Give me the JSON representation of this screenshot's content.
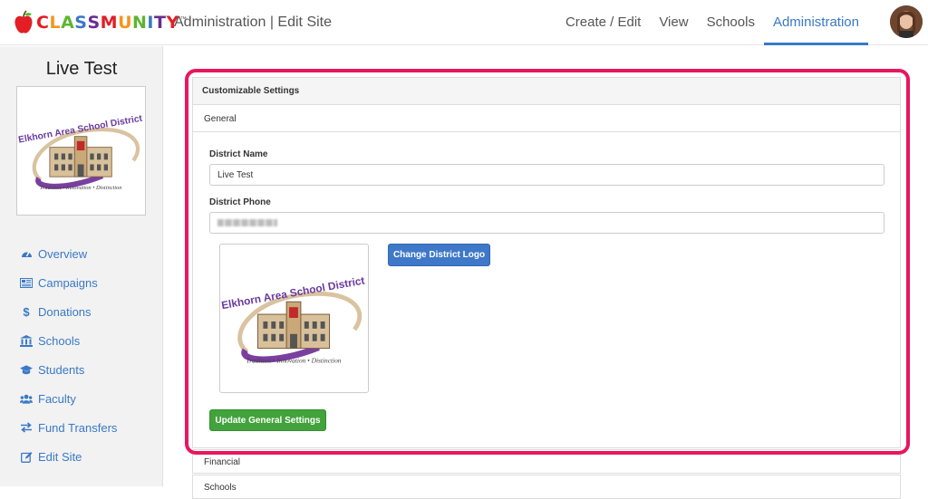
{
  "app": {
    "brand": "CLASSMUNITY",
    "brand_tm": "™",
    "page_title": "Administration | Edit Site",
    "brand_colors": [
      "#e31e24",
      "#f7941d",
      "#5cb531",
      "#3a79c6",
      "#662d91"
    ]
  },
  "nav": {
    "items": [
      {
        "label": "Create / Edit"
      },
      {
        "label": "View"
      },
      {
        "label": "Schools"
      },
      {
        "label": "Administration"
      }
    ],
    "active": "Administration",
    "accent": "#3a79c6"
  },
  "sidebar": {
    "site_name": "Live Test",
    "items": [
      {
        "label": "Overview",
        "icon": "dashboard-icon"
      },
      {
        "label": "Campaigns",
        "icon": "newspaper-icon"
      },
      {
        "label": "Donations",
        "icon": "dollar-icon"
      },
      {
        "label": "Schools",
        "icon": "bank-icon"
      },
      {
        "label": "Students",
        "icon": "graduation-cap-icon"
      },
      {
        "label": "Faculty",
        "icon": "users-icon"
      },
      {
        "label": "Fund Transfers",
        "icon": "exchange-icon"
      },
      {
        "label": "Edit Site",
        "icon": "edit-icon"
      }
    ]
  },
  "district_logo": {
    "name": "Elkhorn Area School District",
    "tagline_parts": [
      "Tradition",
      "Innovation",
      "Distinction"
    ],
    "tagline_sep": "•"
  },
  "settings": {
    "panel_title": "Customizable Settings",
    "section_general": "General",
    "district_name_label": "District Name",
    "district_name_value": "Live Test",
    "district_phone_label": "District Phone",
    "change_logo_button": "Change District Logo",
    "update_button": "Update General Settings",
    "section_financial": "Financial",
    "section_next": "Schools",
    "highlight_color": "#e8175d"
  }
}
